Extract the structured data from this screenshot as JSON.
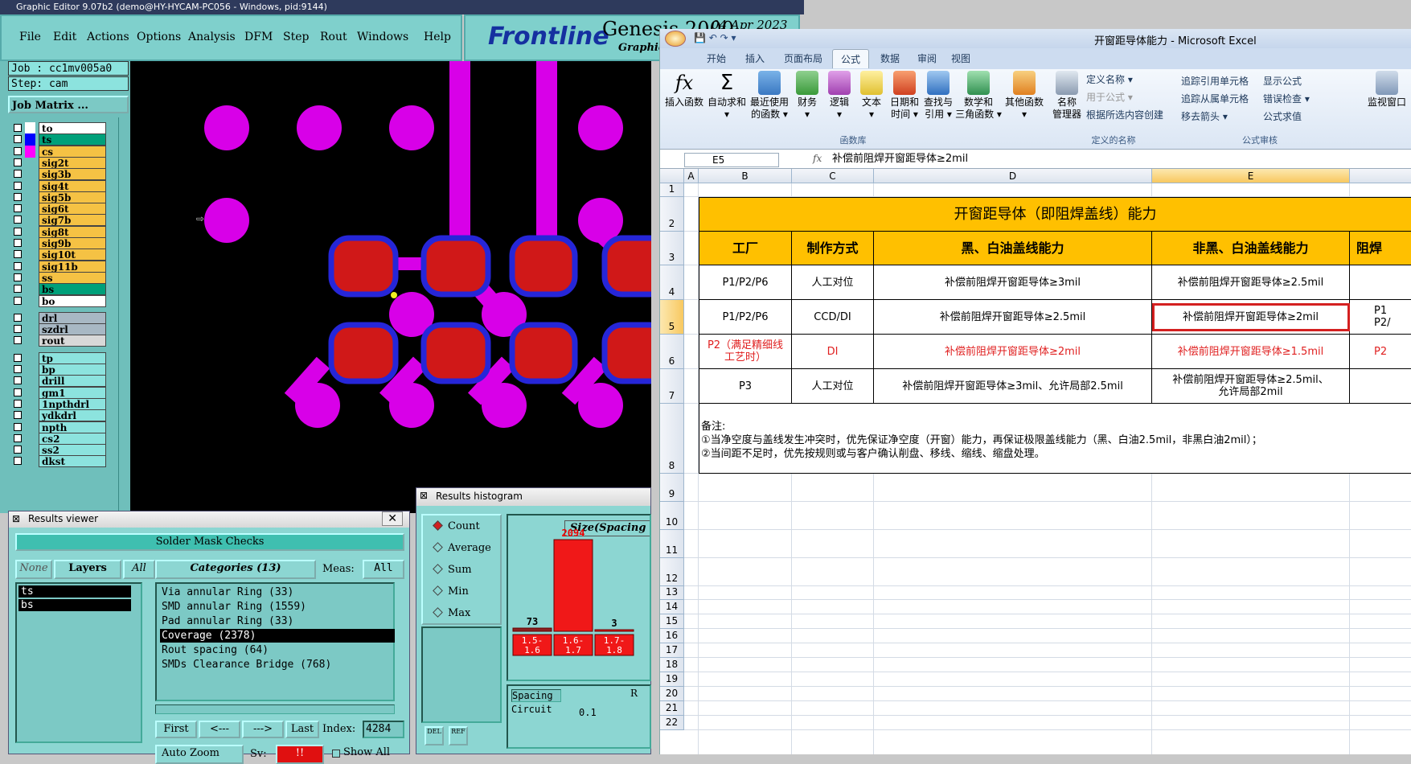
{
  "genesis": {
    "title": "Graphic Editor 9.07b2 (demo@HY-HYCAM-PC056 - Windows, pid:9144)",
    "menu": [
      "File",
      "Edit",
      "Actions",
      "Options",
      "Analysis",
      "DFM",
      "Step",
      "Rout",
      "Windows",
      "Help"
    ],
    "logo": {
      "brand": "Frontline",
      "product": "Genesis 2000",
      "date": "04 Apr 2023",
      "sub": "Graphic"
    },
    "job": "Job : cc1mv005a0",
    "step": "Step: cam",
    "matrix_button": "Job Matrix ...",
    "layers": [
      {
        "name": "to",
        "bg": "#ffffff",
        "color": "#ffffff"
      },
      {
        "name": "ts",
        "bg": "#00a07a",
        "color": "#0000ff",
        "selected": true
      },
      {
        "name": "cs",
        "bg": "#f5c244",
        "color": "#ff00ff"
      },
      {
        "name": "sig2t",
        "bg": "#f5c244",
        "color": ""
      },
      {
        "name": "sig3b",
        "bg": "#f5c244",
        "color": ""
      },
      {
        "name": "sig4t",
        "bg": "#f5c244",
        "color": ""
      },
      {
        "name": "sig5b",
        "bg": "#f5c244",
        "color": ""
      },
      {
        "name": "sig6t",
        "bg": "#f5c244",
        "color": ""
      },
      {
        "name": "sig7b",
        "bg": "#f5c244",
        "color": ""
      },
      {
        "name": "sig8t",
        "bg": "#f5c244",
        "color": ""
      },
      {
        "name": "sig9b",
        "bg": "#f5c244",
        "color": ""
      },
      {
        "name": "sig10t",
        "bg": "#f5c244",
        "color": ""
      },
      {
        "name": "sig11b",
        "bg": "#f5c244",
        "color": ""
      },
      {
        "name": "ss",
        "bg": "#f5c244",
        "color": ""
      },
      {
        "name": "bs",
        "bg": "#00a07a",
        "color": ""
      },
      {
        "name": "bo",
        "bg": "#ffffff",
        "color": ""
      },
      {
        "name": "drl",
        "bg": "#a8b8c4",
        "color": ""
      },
      {
        "name": "szdrl",
        "bg": "#a8b8c4",
        "color": ""
      },
      {
        "name": "rout",
        "bg": "#d8d8d8",
        "color": ""
      },
      {
        "name": "tp",
        "bg": "#8ce3de",
        "color": ""
      },
      {
        "name": "bp",
        "bg": "#8ce3de",
        "color": ""
      },
      {
        "name": "drill",
        "bg": "#8ce3de",
        "color": ""
      },
      {
        "name": "gm1",
        "bg": "#8ce3de",
        "color": ""
      },
      {
        "name": "1npthdrl",
        "bg": "#8ce3de",
        "color": ""
      },
      {
        "name": "ydkdrl",
        "bg": "#8ce3de",
        "color": ""
      },
      {
        "name": "npth",
        "bg": "#8ce3de",
        "color": ""
      },
      {
        "name": "cs2",
        "bg": "#8ce3de",
        "color": ""
      },
      {
        "name": "ss2",
        "bg": "#8ce3de",
        "color": ""
      },
      {
        "name": "dkst",
        "bg": "#8ce3de",
        "color": ""
      }
    ],
    "results_viewer": {
      "title": "Results viewer",
      "header": "Solder Mask Checks",
      "none": "None",
      "layers_btn": "Layers",
      "all_btn": "All",
      "layers": [
        "ts",
        "bs"
      ],
      "categories_label": "Categories (13)",
      "meas_label": "Meas:",
      "meas_value": "All",
      "categories": [
        "Via annular Ring (33)",
        "SMD annular Ring (1559)",
        "Pad annular Ring (33)",
        "Coverage (2378)",
        "Rout spacing (64)",
        "SMDs Clearance Bridge (768)"
      ],
      "selected_category": 3,
      "first": "First",
      "prev": "<---",
      "next": "--->",
      "last": "Last",
      "index_label": "Index:",
      "index_value": "4284",
      "zoom": "Auto Zoom",
      "sv_label": "Sv:",
      "sv_value": "!!",
      "show_all": "Show All"
    },
    "histogram": {
      "title": "Results histogram",
      "options": [
        "Count",
        "Average",
        "Sum",
        "Min",
        "Max"
      ],
      "selected": "Count",
      "chart_title": "Size(Spacing",
      "values": [
        73,
        2094,
        3
      ],
      "bins": [
        [
          "1.5-",
          "1.6"
        ],
        [
          "1.6-",
          "1.7"
        ],
        [
          "1.7-",
          "1.8"
        ]
      ],
      "spacing": "Spacing",
      "circuit": "Circuit",
      "r": "R",
      "min_val": "0.1",
      "del": "DEL",
      "ref": "REF"
    }
  },
  "excel": {
    "title": "开窗距导体能力 - Microsoft Excel",
    "tabs": [
      "开始",
      "插入",
      "页面布局",
      "公式",
      "数据",
      "审阅",
      "视图"
    ],
    "active_tab": "公式",
    "ribbon": {
      "insert_fn": "插入函数",
      "autosum": [
        "自动求和",
        "▾"
      ],
      "recent": [
        "最近使用",
        "的函数 ▾"
      ],
      "finance": [
        "财务",
        "▾"
      ],
      "logic": [
        "逻辑",
        "▾"
      ],
      "text": [
        "文本",
        "▾"
      ],
      "datetime": [
        "日期和",
        "时间 ▾"
      ],
      "lookup": [
        "查找与",
        "引用 ▾"
      ],
      "math": [
        "数学和",
        "三角函数 ▾"
      ],
      "other": [
        "其他函数",
        "▾"
      ],
      "group_lib": "函数库",
      "name_mgr": [
        "名称",
        "管理器"
      ],
      "define": "定义名称 ▾",
      "use_in": "用于公式 ▾",
      "create": "根据所选内容创建",
      "group_names": "定义的名称",
      "trace_pre": "追踪引用单元格",
      "trace_dep": "追踪从属单元格",
      "remove": "移去箭头 ▾",
      "show": "显示公式",
      "error": "错误检查 ▾",
      "eval": "公式求值",
      "group_audit": "公式审核",
      "watch": "监视窗口"
    },
    "namebox": "E5",
    "formula": "补偿前阻焊开窗距导体≥2mil",
    "columns": [
      "A",
      "B",
      "C",
      "D",
      "E"
    ],
    "rows": [
      "1",
      "2",
      "3",
      "4",
      "5",
      "6",
      "7",
      "8",
      "9",
      "10",
      "11",
      "12",
      "13",
      "14",
      "15",
      "16",
      "17",
      "18",
      "19",
      "20",
      "21",
      "22"
    ],
    "table": {
      "title": "开窗距导体（即阻焊盖线）能力",
      "headers": [
        "工厂",
        "制作方式",
        "黑、白油盖线能力",
        "非黑、白油盖线能力",
        "阻焊"
      ],
      "r4": [
        "P1/P2/P6",
        "人工对位",
        "补偿前阻焊开窗距导体≥3mil",
        "补偿前阻焊开窗距导体≥2.5mil"
      ],
      "r5": [
        "P1/P2/P6",
        "CCD/DI",
        "补偿前阻焊开窗距导体≥2.5mil",
        "补偿前阻焊开窗距导体≥2mil",
        "P1",
        "P2/"
      ],
      "r6": [
        "P2（满足精细线",
        "工艺时）",
        "DI",
        "补偿前阻焊开窗距导体≥2mil",
        "补偿前阻焊开窗距导体≥1.5mil",
        "P2"
      ],
      "r7": [
        "P3",
        "人工对位",
        "补偿前阻焊开窗距导体≥3mil、允许局部2.5mil",
        "补偿前阻焊开窗距导体≥2.5mil、",
        "允许局部2mil"
      ],
      "notes": [
        "备注:",
        "①当净空度与盖线发生冲突时，优先保证净空度（开窗）能力，再保证极限盖线能力（黑、白油2.5mil，非黑白油2mil）；",
        "②当间距不足时，优先按规则或与客户确认削盘、移线、缩线、缩盘处理。"
      ]
    }
  }
}
